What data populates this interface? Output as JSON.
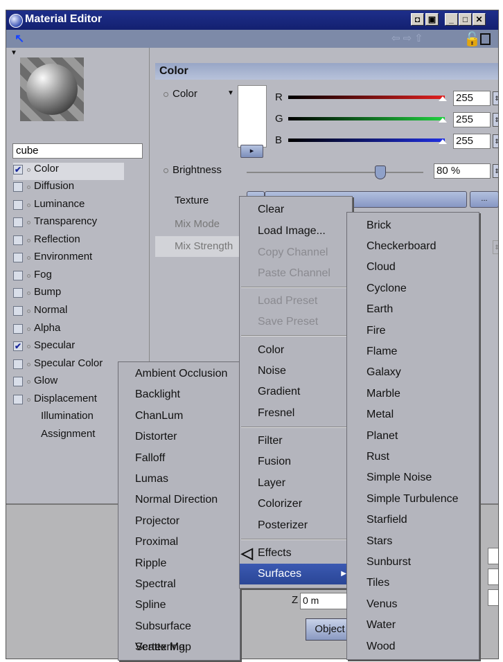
{
  "window": {
    "title": "Material Editor",
    "controls": [
      "◘",
      "▣",
      "_",
      "□",
      "✕"
    ]
  },
  "material": {
    "name": "cube"
  },
  "channels": [
    {
      "label": "Color",
      "checked": true,
      "selected": true
    },
    {
      "label": "Diffusion",
      "checked": false
    },
    {
      "label": "Luminance",
      "checked": false
    },
    {
      "label": "Transparency",
      "checked": false
    },
    {
      "label": "Reflection",
      "checked": false
    },
    {
      "label": "Environment",
      "checked": false
    },
    {
      "label": "Fog",
      "checked": false
    },
    {
      "label": "Bump",
      "checked": false
    },
    {
      "label": "Normal",
      "checked": false
    },
    {
      "label": "Alpha",
      "checked": false
    },
    {
      "label": "Specular",
      "checked": true
    },
    {
      "label": "Specular Color",
      "checked": false
    },
    {
      "label": "Glow",
      "checked": false
    },
    {
      "label": "Displacement",
      "checked": false
    }
  ],
  "extra_items": [
    "Illumination",
    "Assignment"
  ],
  "color_section": {
    "header": "Color",
    "color_label": "Color",
    "r_label": "R",
    "g_label": "G",
    "b_label": "B",
    "r_value": "255",
    "g_value": "255",
    "b_value": "255",
    "brightness_label": "Brightness",
    "brightness_value": "80 %",
    "brightness_level": 0.8,
    "texture_label": "Texture",
    "texture_more": "...",
    "mix_mode_label": "Mix Mode",
    "mix_strength_label": "Mix Strength"
  },
  "coordinates": {
    "z_label": "Z",
    "z_value": "0 m",
    "object_button": "Object"
  },
  "texture_menu": {
    "items": [
      "Clear",
      "Load Image...",
      "Copy Channel",
      "Paste Channel",
      "Load Preset",
      "Save Preset",
      "Color",
      "Noise",
      "Gradient",
      "Fresnel",
      "Filter",
      "Fusion",
      "Layer",
      "Colorizer",
      "Posterizer",
      "Effects",
      "Surfaces"
    ]
  },
  "surfaces_menu": {
    "items": [
      "Brick",
      "Checkerboard",
      "Cloud",
      "Cyclone",
      "Earth",
      "Fire",
      "Flame",
      "Galaxy",
      "Marble",
      "Metal",
      "Planet",
      "Rust",
      "Simple Noise",
      "Simple Turbulence",
      "Starfield",
      "Stars",
      "Sunburst",
      "Tiles",
      "Venus",
      "Water",
      "Wood"
    ]
  },
  "effects_menu": {
    "items": [
      "Ambient Occlusion",
      "Backlight",
      "ChanLum",
      "Distorter",
      "Falloff",
      "Lumas",
      "Normal Direction",
      "Projector",
      "Proximal",
      "Ripple",
      "Spectral",
      "Spline",
      "Subsurface Scattering",
      "Vertex Map"
    ]
  },
  "colors": {
    "title_bar": "#1e2f8a",
    "highlight": "#2a4696",
    "panel": "#b8b9c1"
  }
}
